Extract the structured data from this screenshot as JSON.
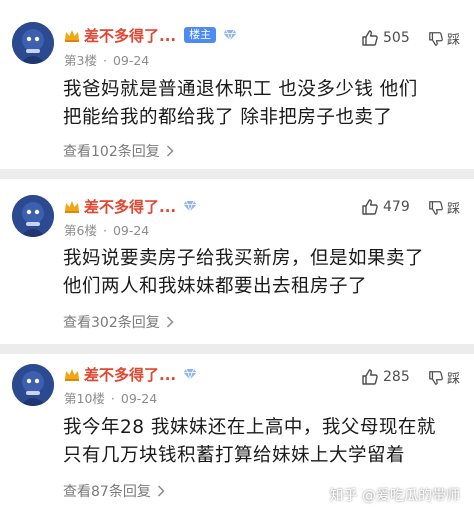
{
  "comments": [
    {
      "user_name": "差不多得了...",
      "op_badge": "楼主",
      "floor": "第3楼",
      "date": "09-24",
      "likes": "505",
      "dislike_label": "踩",
      "text_lines": [
        "我爸妈就是普通退休职工 也没多少钱 他们",
        "把能给我的都给我了 除非把房子也卖了"
      ],
      "reply_text": "查看102条回复"
    },
    {
      "user_name": "差不多得了...",
      "floor": "第6楼",
      "date": "09-24",
      "likes": "479",
      "dislike_label": "踩",
      "text_lines": [
        "我妈说要卖房子给我买新房，但是如果卖了",
        "他们两人和我妹妹都要出去租房子了"
      ],
      "reply_text": "查看302条回复"
    },
    {
      "user_name": "差不多得了...",
      "floor": "第10楼",
      "date": "09-24",
      "likes": "285",
      "dislike_label": "踩",
      "text_lines": [
        "我今年28 我妹妹还在上高中，我父母现在就",
        "只有几万块钱积蓄打算给妹妹上大学留着"
      ],
      "reply_text": "查看87条回复"
    }
  ],
  "watermark": "知乎 @爱吃瓜的带师",
  "colors": {
    "username": "#e3452f",
    "op_badge_bg": "#4c8bf5",
    "meta_text": "#8c8c8c",
    "divider_bg": "#ececec"
  },
  "icons": {
    "crown": "crown-icon",
    "level": "diamond-level-icon",
    "like": "thumbs-up-icon",
    "dislike": "thumbs-down-icon",
    "reply_arrow": "chevron-right-icon"
  }
}
